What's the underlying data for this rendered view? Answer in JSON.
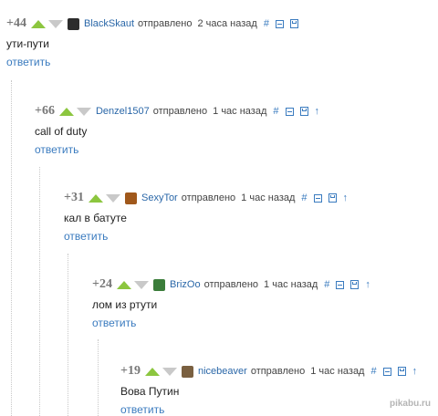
{
  "comments": [
    {
      "rating": "+44",
      "username": "BlackSkaut",
      "sent": "отправлено",
      "time": "2 часа назад",
      "anchor": "#",
      "text": "ути-пути",
      "reply": "ответить",
      "has_parent_link": false,
      "avatar_color": "#2c2c2c"
    },
    {
      "rating": "+66",
      "username": "Denzel1507",
      "sent": "отправлено",
      "time": "1 час назад",
      "anchor": "#",
      "parent": "↑",
      "text": "call of duty",
      "reply": "ответить",
      "has_parent_link": true,
      "avatar_color": null
    },
    {
      "rating": "+31",
      "username": "SexyTor",
      "sent": "отправлено",
      "time": "1 час назад",
      "anchor": "#",
      "parent": "↑",
      "text": "кал в батуте",
      "reply": "ответить",
      "has_parent_link": true,
      "avatar_color": "#a0581b"
    },
    {
      "rating": "+24",
      "username": "BrizOo",
      "sent": "отправлено",
      "time": "1 час назад",
      "anchor": "#",
      "parent": "↑",
      "text": "лом из ртути",
      "reply": "ответить",
      "has_parent_link": true,
      "avatar_color": "#3b7d3a"
    },
    {
      "rating": "+19",
      "username": "nicebeaver",
      "sent": "отправлено",
      "time": "1 час назад",
      "anchor": "#",
      "parent": "↑",
      "text": "Вова Путин",
      "reply": "ответить",
      "has_parent_link": true,
      "avatar_color": "#7a6040"
    }
  ],
  "watermark": "pikabu.ru",
  "colors": {
    "vote_up": "#8cc63f",
    "vote_down": "#c9c9c9",
    "link": "#3a7bbf",
    "username": "#2a67a8"
  }
}
